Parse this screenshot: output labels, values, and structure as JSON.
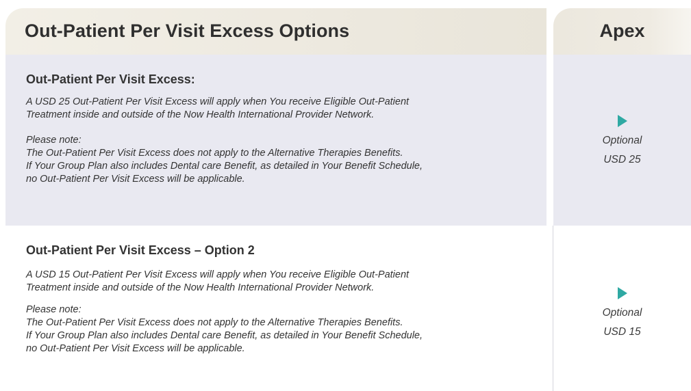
{
  "header": {
    "title": "Out-Patient Per Visit Excess Options",
    "column": "Apex"
  },
  "sections": [
    {
      "heading": "Out-Patient Per Visit Excess:",
      "intro_line1": "A USD 25 Out-Patient Per Visit Excess will apply when You receive Eligible Out-Patient",
      "intro_line2": "Treatment inside and outside of the Now Health International Provider Network.",
      "note_label": "Please note:",
      "note_line1": "The Out-Patient Per Visit Excess does not apply to the Alternative Therapies Benefits.",
      "note_line2": "If Your Group Plan also includes Dental care Benefit, as detailed in Your Benefit Schedule,",
      "note_line3": "no Out-Patient Per Visit Excess will be applicable.",
      "apex_status": "Optional",
      "apex_value": "USD 25"
    },
    {
      "heading": "Out-Patient Per Visit Excess – Option 2",
      "intro_line1": "A USD 15 Out-Patient Per Visit Excess will apply when You receive Eligible Out-Patient",
      "intro_line2": "Treatment inside and outside of the Now Health International Provider Network.",
      "note_label": "Please note:",
      "note_line1": "The Out-Patient Per Visit Excess does not apply to the Alternative Therapies Benefits.",
      "note_line2": "If Your Group Plan also includes Dental care Benefit, as detailed in Your Benefit Schedule,",
      "note_line3": "no Out-Patient Per Visit Excess will be applicable.",
      "apex_status": "Optional",
      "apex_value": "USD 15"
    }
  ],
  "colors": {
    "accent_teal": "#2fa9a3",
    "header_beige": "#efebe2",
    "row_lavender": "#e9e9f1"
  }
}
